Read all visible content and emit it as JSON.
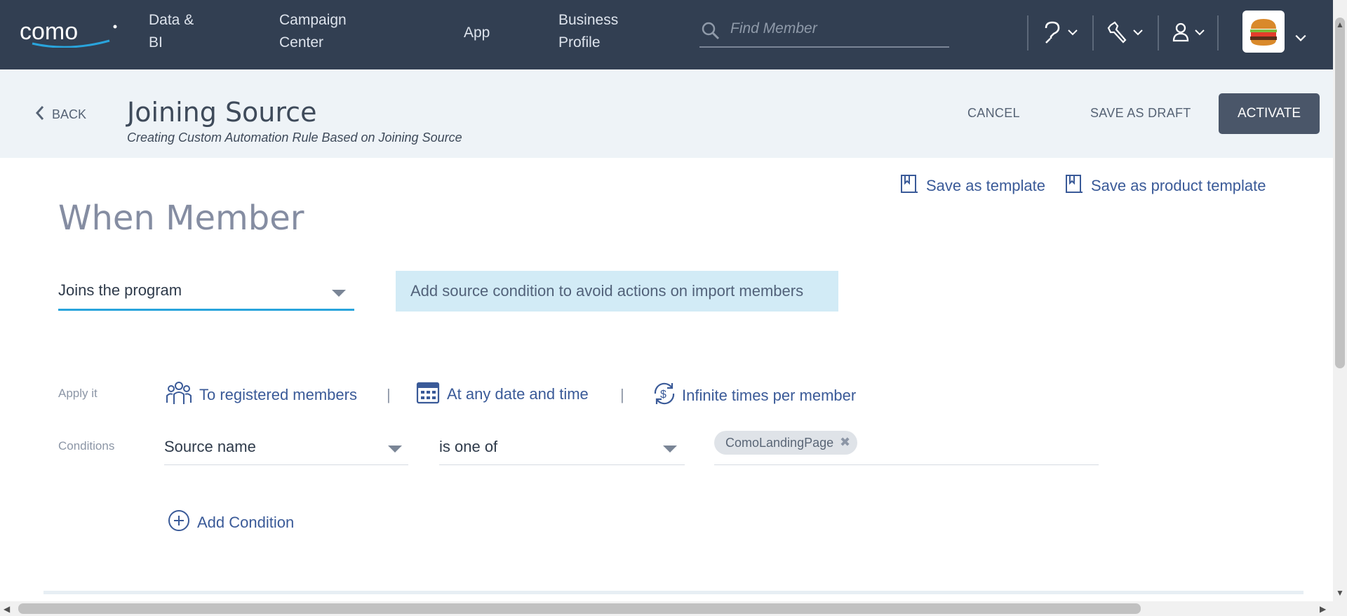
{
  "topbar": {
    "logo": "como",
    "nav": [
      {
        "label_line1": "Data &",
        "label_line2": "BI"
      },
      {
        "label_line1": "Campaign",
        "label_line2": "Center"
      },
      {
        "label_line1": "App",
        "label_line2": ""
      },
      {
        "label_line1": "Business",
        "label_line2": "Profile"
      }
    ],
    "search_placeholder": "Find Member",
    "icons": [
      "help-icon",
      "tools-icon",
      "user-icon"
    ],
    "avatar": "burger-avatar"
  },
  "header": {
    "back_label": "BACK",
    "title": "Joining Source",
    "subtitle": "Creating Custom Automation Rule Based on Joining Source",
    "cancel_label": "CANCEL",
    "draft_label": "SAVE AS DRAFT",
    "activate_label": "ACTIVATE"
  },
  "templates": {
    "save_template_label": "Save as template",
    "save_product_template_label": "Save as product template"
  },
  "rule": {
    "heading": "When Member",
    "trigger_value": "Joins the program",
    "hint": "Add source condition to avoid actions on import members",
    "apply_label": "Apply it",
    "apply_members": "To registered members",
    "apply_time": "At any date and time",
    "apply_frequency": "Infinite times per member",
    "conditions_label": "Conditions",
    "condition_field": "Source name",
    "condition_operator": "is one of",
    "condition_tags": [
      "ComoLandingPage"
    ],
    "add_condition_label": "Add Condition"
  },
  "colors": {
    "topbar": "#323f52",
    "accent_link": "#3a5a98",
    "focus_underline": "#29a4dc",
    "hint_bg": "#d2ebf6",
    "activate_bg": "#4a5669"
  }
}
